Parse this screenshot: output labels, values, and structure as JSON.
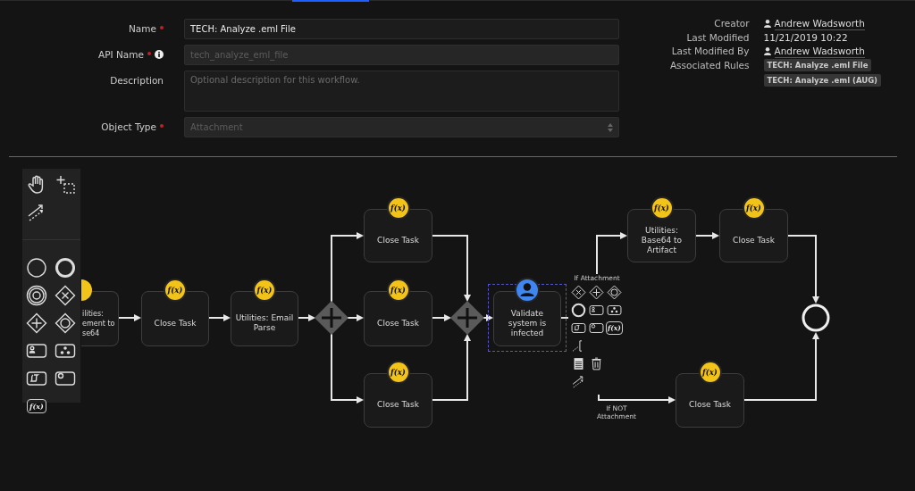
{
  "form": {
    "fields": [
      {
        "kind": "text",
        "label": "Name",
        "required": true,
        "info": false,
        "value": "TECH: Analyze .eml File",
        "disabled": false
      },
      {
        "kind": "text",
        "label": "API Name",
        "required": true,
        "info": true,
        "value": "tech_analyze_eml_file",
        "disabled": true
      },
      {
        "kind": "textarea",
        "label": "Description",
        "required": false,
        "info": false,
        "placeholder": "Optional description for this workflow."
      },
      {
        "kind": "select",
        "label": "Object Type",
        "required": true,
        "info": false,
        "value": "Attachment",
        "disabled": true
      }
    ]
  },
  "meta": [
    {
      "label": "Creator",
      "kind": "user",
      "value": "Andrew Wadsworth"
    },
    {
      "label": "Last Modified",
      "kind": "text",
      "value": "11/21/2019 10:22"
    },
    {
      "label": "Last Modified By",
      "kind": "user",
      "value": "Andrew Wadsworth"
    },
    {
      "label": "Associated Rules",
      "kind": "tags",
      "tags": [
        "TECH: Analyze .eml File",
        "TECH: Analyze .eml (AUG)"
      ]
    }
  ],
  "palette": {
    "tools": [
      {
        "kind": "hand"
      },
      {
        "kind": "lasso"
      },
      {
        "kind": "connect"
      },
      {
        "kind": "start-event"
      },
      {
        "kind": "end-event"
      },
      {
        "kind": "intermediate-event"
      },
      {
        "kind": "exclusive-gateway"
      },
      {
        "kind": "parallel-gateway"
      },
      {
        "kind": "event-gateway"
      },
      {
        "kind": "user-task"
      },
      {
        "kind": "subprocess"
      },
      {
        "kind": "script-task"
      },
      {
        "kind": "service-task"
      },
      {
        "kind": "function-task",
        "label": "f(x)"
      }
    ]
  },
  "diagram": {
    "nodes": [
      {
        "kind": "partial-task",
        "label": "ilities:\nement to\nse64",
        "selected": false
      },
      {
        "kind": "function-task",
        "badge": "f(x)",
        "label": "Close Task",
        "selected": false
      },
      {
        "kind": "function-task",
        "badge": "f(x)",
        "label": "Utilities: Email Parse",
        "selected": false
      },
      {
        "kind": "parallel-gateway"
      },
      {
        "kind": "function-task",
        "badge": "f(x)",
        "label": "Close Task",
        "selected": false
      },
      {
        "kind": "function-task",
        "badge": "f(x)",
        "label": "Close Task",
        "selected": false
      },
      {
        "kind": "function-task",
        "badge": "f(x)",
        "label": "Close Task",
        "selected": false
      },
      {
        "kind": "parallel-gateway"
      },
      {
        "kind": "user-task",
        "label": "Validate system is infected",
        "selected": true
      },
      {
        "kind": "function-task",
        "badge": "f(x)",
        "label": "Utilities: Base64 to Artifact",
        "selected": false
      },
      {
        "kind": "function-task",
        "badge": "f(x)",
        "label": "Close Task",
        "selected": false
      },
      {
        "kind": "end-event"
      },
      {
        "kind": "function-task",
        "badge": "f(x)",
        "label": "Close Task",
        "selected": false
      }
    ],
    "edge_labels": [
      "If Attachment",
      "If NOT Attachment"
    ],
    "context_pad": [
      {
        "kind": "exclusive-gateway"
      },
      {
        "kind": "parallel-gateway"
      },
      {
        "kind": "event-gateway"
      },
      {
        "kind": "end-event"
      },
      {
        "kind": "user-task"
      },
      {
        "kind": "subprocess"
      },
      {
        "kind": "script-task"
      },
      {
        "kind": "service-task"
      },
      {
        "kind": "function-task",
        "label": "f(x)"
      },
      {
        "kind": "annotation"
      },
      {
        "kind": "data-store"
      },
      {
        "kind": "delete"
      },
      {
        "kind": "connect"
      }
    ]
  }
}
